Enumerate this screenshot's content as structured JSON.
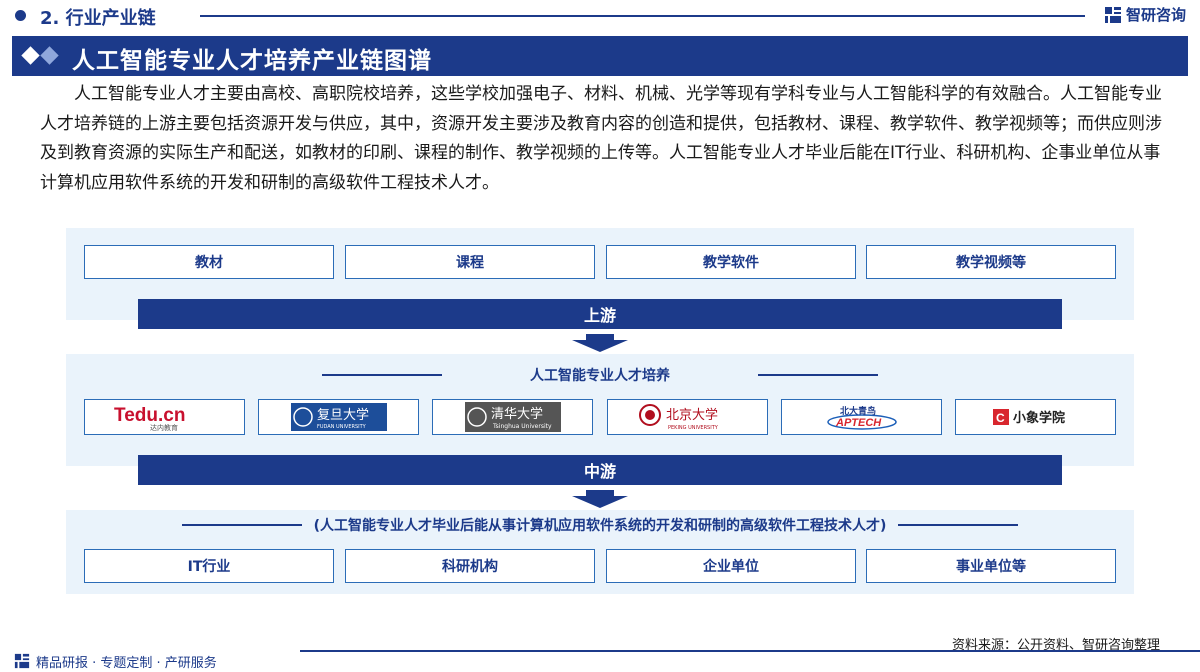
{
  "header": {
    "section": "2. 行业产业链",
    "brand": "智研咨询"
  },
  "title": "人工智能专业人才培养产业链图谱",
  "paragraph": "人工智能专业人才主要由高校、高职院校培养，这些学校加强电子、材料、机械、光学等现有学科专业与人工智能科学的有效融合。人工智能专业人才培养链的上游主要包括资源开发与供应，其中，资源开发主要涉及教育内容的创造和提供，包括教材、课程、教学软件、教学视频等；而供应则涉及到教育资源的实际生产和配送，如教材的印刷、课程的制作、教学视频的上传等。人工智能专业人才毕业后能在IT行业、科研机构、企事业单位从事计算机应用软件系统的开发和研制的高级软件工程技术人才。",
  "upstream": {
    "items": [
      "教材",
      "课程",
      "教学软件",
      "教学视频等"
    ],
    "label": "上游"
  },
  "midstream": {
    "header": "人工智能专业人才培养",
    "logos": [
      {
        "main": "Tedu.cn",
        "sub": "达内教育",
        "icon": "tedu-logo"
      },
      {
        "main": "复旦大学",
        "sub": "FUDAN UNIVERSITY",
        "icon": "fudan-logo"
      },
      {
        "main": "清华大学",
        "sub": "Tsinghua University",
        "icon": "tsinghua-logo"
      },
      {
        "main": "北京大学",
        "sub": "PEKING UNIVERSITY",
        "icon": "pku-logo"
      },
      {
        "main": "北大青鸟",
        "sub": "APTECH",
        "icon": "aptech-logo"
      },
      {
        "main": "小象学院",
        "sub": "",
        "icon": "xiaoxiang-logo"
      }
    ],
    "label": "中游"
  },
  "downstream": {
    "header": "(人工智能专业人才毕业后能从事计算机应用软件系统的开发和研制的高级软件工程技术人才)",
    "items": [
      "IT行业",
      "科研机构",
      "企业单位",
      "事业单位等"
    ]
  },
  "source": "资料来源：公开资料、智研咨询整理",
  "footer": "精品研报 · 专题定制 · 产研服务",
  "colors": {
    "primary": "#1c3a8a",
    "border": "#2b6cb7",
    "panel": "#eaf3fb"
  }
}
